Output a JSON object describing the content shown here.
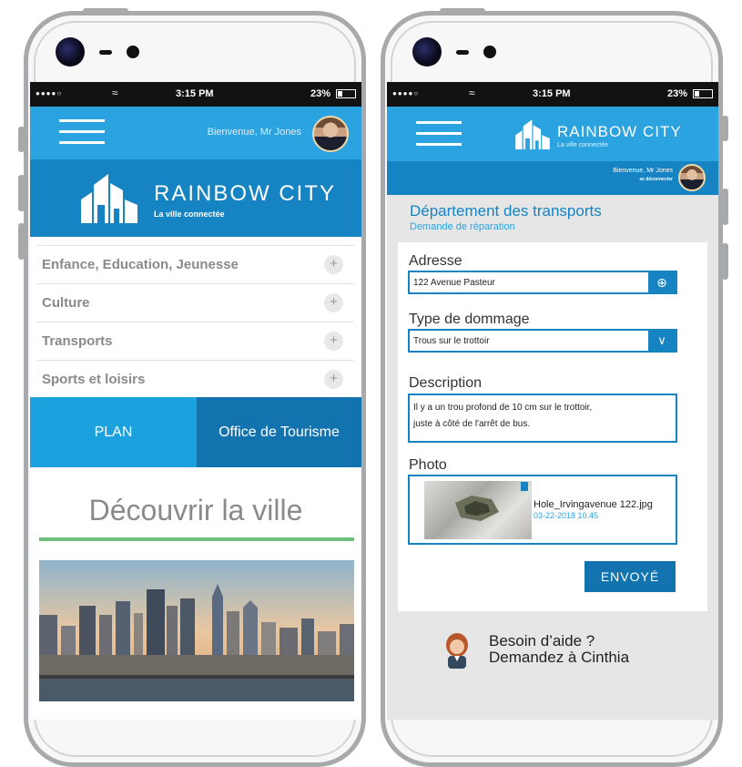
{
  "status": {
    "time": "3:15 PM",
    "battery": "23%"
  },
  "phone1": {
    "welcome": "Bienvenue, Mr Jones",
    "brand_title": "RAINBOW CITY",
    "brand_sub": "La ville connectée",
    "menu": [
      {
        "label": "Enfance, Education, Jeunesse"
      },
      {
        "label": "Culture"
      },
      {
        "label": "Transports"
      },
      {
        "label": "Sports et loisirs"
      }
    ],
    "plus": "+",
    "plan_label": "PLAN",
    "office_label": "Office de Tourisme",
    "discover_title": "Découvrir la ville",
    "accent_color": "#6cc07a"
  },
  "phone2": {
    "brand_title": "RAINBOW CITY",
    "brand_sub": "La ville connectée",
    "welcome": "Bienvenue, Mr Jones",
    "logout": "se déconnecter",
    "dept_title": "Département des transports",
    "dept_sub": "Demande de réparation",
    "address_label": "Adresse",
    "address_value": "122 Avenue Pasteur",
    "damage_label": "Type de dommage",
    "damage_value": "Trous sur le trottoir",
    "description_label": "Description",
    "description_line1": "Il y a un trou profond de 10 cm sur le trottoir,",
    "description_line2": "juste à côté de l'arrêt de bus.",
    "photo_label": "Photo",
    "photo_filename": "Hole_Irvingavenue 122.jpg",
    "photo_timestamp": "03-22-2018 10.45",
    "submit_label": "ENVOYÉ",
    "help_line1": "Besoin d’aide ?",
    "help_line2": "Demandez à Cinthia"
  },
  "colors": {
    "primary": "#1683c2",
    "light_blue": "#2aa3e0",
    "dark_blue": "#1273af"
  }
}
